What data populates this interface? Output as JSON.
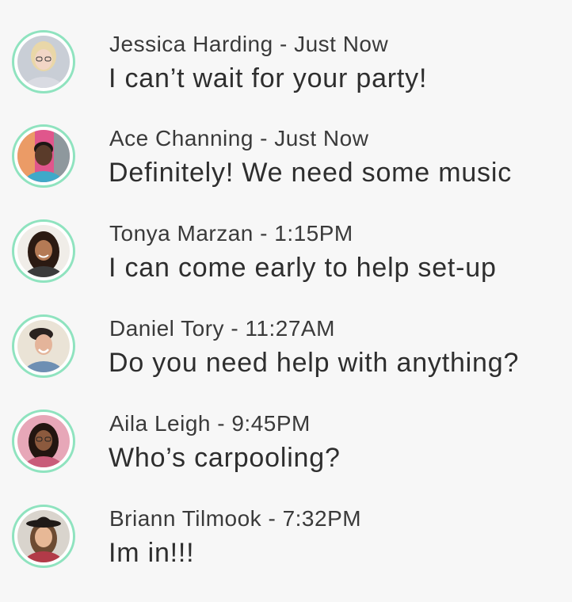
{
  "messages": [
    {
      "name": "Jessica Harding",
      "time": "Just Now",
      "meta": "Jessica Harding - Just Now",
      "text": "I can’t wait for your party!",
      "avatar": {
        "bg": "#c9ced6",
        "skin": "#f2d6c6",
        "hair": "#e9d7a8",
        "shirt": "#d9dbe2"
      }
    },
    {
      "name": "Ace Channing",
      "time": "Just Now",
      "meta": "Ace Channing - Just Now",
      "text": "Definitely! We need some music",
      "avatar": {
        "bg": "#e0568c",
        "skin": "#5a3b2a",
        "hair": "#1d1714",
        "shirt": "#3fa9c9"
      }
    },
    {
      "name": "Tonya Marzan",
      "time": "1:15PM",
      "meta": "Tonya Marzan - 1:15PM",
      "text": "I can come early to help set-up",
      "avatar": {
        "bg": "#f0ede8",
        "skin": "#b47a55",
        "hair": "#2b1a12",
        "shirt": "#3b3b3b"
      }
    },
    {
      "name": "Daniel Tory",
      "time": "11:27AM",
      "meta": "Daniel Tory - 11:27AM",
      "text": "Do you need help with anything?",
      "avatar": {
        "bg": "#eae3d6",
        "skin": "#e4b49a",
        "hair": "#2a2220",
        "shirt": "#6e8fb3"
      }
    },
    {
      "name": "Aila Leigh",
      "time": "9:45PM",
      "meta": "Aila Leigh - 9:45PM",
      "text": "Who’s carpooling?",
      "avatar": {
        "bg": "#e7a7b8",
        "skin": "#8c5a3e",
        "hair": "#221510",
        "shirt": "#c95c7a"
      }
    },
    {
      "name": "Briann Tilmook",
      "time": "7:32PM",
      "meta": "Briann Tilmook - 7:32PM",
      "text": "Im in!!!",
      "avatar": {
        "bg": "#d9d4cd",
        "skin": "#e7b896",
        "hair": "#6d4b32",
        "shirt": "#b23a48",
        "hat": "#1f1a18"
      }
    }
  ]
}
